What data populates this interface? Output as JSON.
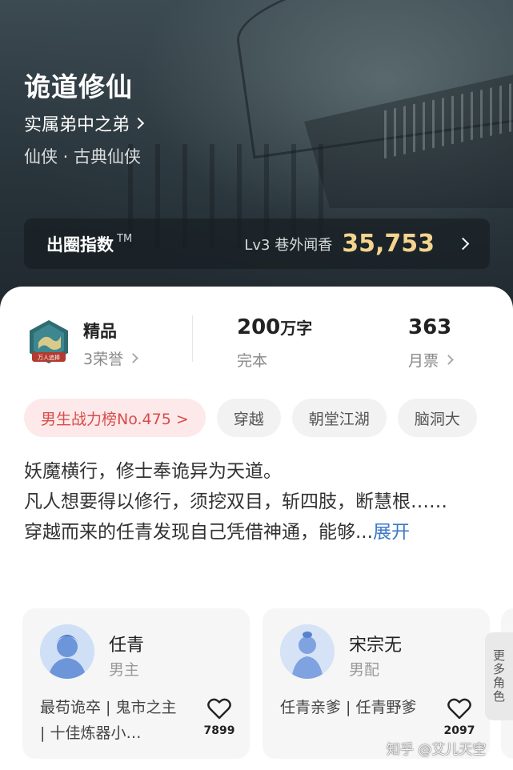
{
  "book": {
    "title": "诡道修仙",
    "author": "实属弟中之弟",
    "genre": "仙侠 · 古典仙侠"
  },
  "influence_index": {
    "label": "出圈指数",
    "trademark": "TM",
    "level": "Lv3 巷外闻香",
    "score": "35,753",
    "score_color": "#f4d48e"
  },
  "stats": {
    "badge_text": "万人追捧",
    "quality": "精品",
    "honors": "3荣誉",
    "word_count_number": "200",
    "word_count_unit": "万字",
    "status": "完本",
    "monthly_tickets": "363",
    "monthly_tickets_label": "月票"
  },
  "tags": [
    {
      "label": "男生战力榜No.475 >"
    },
    {
      "label": "穿越"
    },
    {
      "label": "朝堂江湖"
    },
    {
      "label": "脑洞大"
    }
  ],
  "synopsis": {
    "line1": "妖魔横行，修士奉诡异为天道。",
    "line2": "凡人想要得以修行，须挖双目，斩四肢，断慧根……",
    "line3": "穿越而来的任青发现自己凭借神通，能够...",
    "expand": "展开"
  },
  "roles": [
    {
      "name": "任青",
      "role": "男主",
      "desc": "最苟诡卒 | 鬼市之主 | 十佳炼器小…",
      "likes": "7899"
    },
    {
      "name": "宋宗无",
      "role": "男配",
      "desc": "任青亲爹 | 任青野爹",
      "likes": "2097"
    }
  ],
  "more_roles": "更多角色",
  "watermark": "知乎 @艾儿天空",
  "colors": {
    "accent_link": "#3a79c6",
    "rank_tag_text": "#d84b4b",
    "rank_tag_bg": "#fde9e9"
  }
}
